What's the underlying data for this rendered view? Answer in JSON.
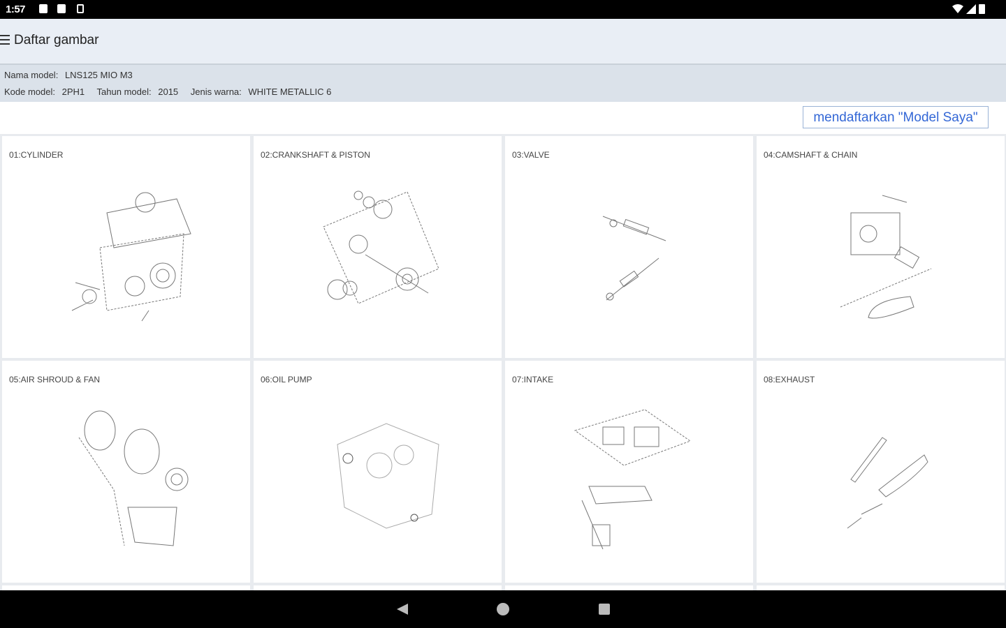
{
  "status": {
    "time": "1:57"
  },
  "header": {
    "title": "Daftar gambar"
  },
  "model_info": {
    "name_label": "Nama model:",
    "name_value": "LNS125 MIO M3",
    "code_label": "Kode model:",
    "code_value": "2PH1",
    "year_label": "Tahun model:",
    "year_value": "2015",
    "color_label": "Jenis warna:",
    "color_value": "WHITE METALLIC 6"
  },
  "register_button": "mendaftarkan \"Model Saya\"",
  "diagrams": [
    {
      "label": "01:CYLINDER"
    },
    {
      "label": "02:CRANKSHAFT & PISTON"
    },
    {
      "label": "03:VALVE"
    },
    {
      "label": "04:CAMSHAFT & CHAIN"
    },
    {
      "label": "05:AIR SHROUD & FAN"
    },
    {
      "label": "06:OIL PUMP"
    },
    {
      "label": "07:INTAKE"
    },
    {
      "label": "08:EXHAUST"
    }
  ],
  "colors": {
    "accent": "#3367d6",
    "appbar": "#e9eef5",
    "infobar": "#dbe2ea"
  }
}
